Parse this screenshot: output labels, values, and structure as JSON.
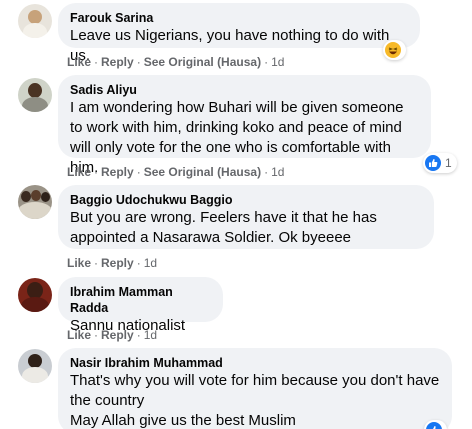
{
  "actions": {
    "like": "Like",
    "reply": "Reply",
    "see_original": "See Original (Hausa)",
    "separator": "·"
  },
  "comments": [
    {
      "author": "Farouk Sarina",
      "text": "Leave us Nigerians, you have nothing to do with us.",
      "time": "1d",
      "reaction": {
        "icon": "haha-emoji-icon",
        "color": "#f7b928",
        "count": ""
      }
    },
    {
      "author": "Sadis Aliyu",
      "text": "I am wondering how Buhari will be given someone to work with him, drinking koko and peace of mind will only vote for the one who is comfortable with him.",
      "time": "1d",
      "reaction": {
        "icon": "like-thumb-icon",
        "color": "#1877f2",
        "count": "1"
      }
    },
    {
      "author": "Baggio Udochukwu Baggio",
      "text": "But you are wrong. Feelers have it that he has appointed a Nasarawa Soldier. Ok byeeee",
      "time": "1d"
    },
    {
      "author": "Ibrahim Mamman Radda",
      "text": "Sannu nationalist",
      "time": "1d"
    },
    {
      "author": "Nasir Ibrahim Muhammad",
      "text_lines": [
        "That's why you will vote for him because you don't have the country",
        "May Allah give us the best Muslim"
      ],
      "reaction": {
        "icon": "like-thumb-icon",
        "color": "#1877f2",
        "count": ""
      }
    }
  ]
}
